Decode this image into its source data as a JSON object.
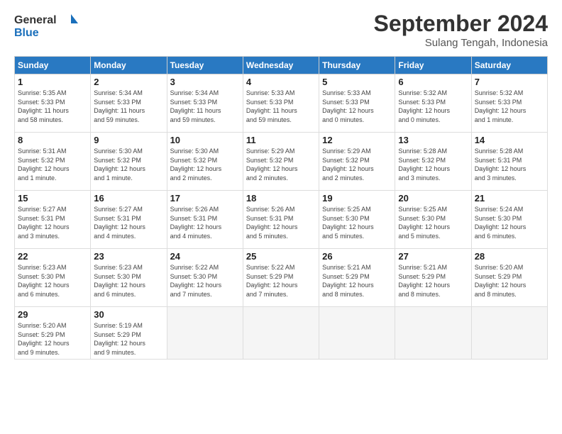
{
  "header": {
    "logo_line1": "General",
    "logo_line2": "Blue",
    "month": "September 2024",
    "location": "Sulang Tengah, Indonesia"
  },
  "weekdays": [
    "Sunday",
    "Monday",
    "Tuesday",
    "Wednesday",
    "Thursday",
    "Friday",
    "Saturday"
  ],
  "weeks": [
    [
      {
        "day": "1",
        "info": "Sunrise: 5:35 AM\nSunset: 5:33 PM\nDaylight: 11 hours\nand 58 minutes."
      },
      {
        "day": "2",
        "info": "Sunrise: 5:34 AM\nSunset: 5:33 PM\nDaylight: 11 hours\nand 59 minutes."
      },
      {
        "day": "3",
        "info": "Sunrise: 5:34 AM\nSunset: 5:33 PM\nDaylight: 11 hours\nand 59 minutes."
      },
      {
        "day": "4",
        "info": "Sunrise: 5:33 AM\nSunset: 5:33 PM\nDaylight: 11 hours\nand 59 minutes."
      },
      {
        "day": "5",
        "info": "Sunrise: 5:33 AM\nSunset: 5:33 PM\nDaylight: 12 hours\nand 0 minutes."
      },
      {
        "day": "6",
        "info": "Sunrise: 5:32 AM\nSunset: 5:33 PM\nDaylight: 12 hours\nand 0 minutes."
      },
      {
        "day": "7",
        "info": "Sunrise: 5:32 AM\nSunset: 5:33 PM\nDaylight: 12 hours\nand 1 minute."
      }
    ],
    [
      {
        "day": "8",
        "info": "Sunrise: 5:31 AM\nSunset: 5:32 PM\nDaylight: 12 hours\nand 1 minute."
      },
      {
        "day": "9",
        "info": "Sunrise: 5:30 AM\nSunset: 5:32 PM\nDaylight: 12 hours\nand 1 minute."
      },
      {
        "day": "10",
        "info": "Sunrise: 5:30 AM\nSunset: 5:32 PM\nDaylight: 12 hours\nand 2 minutes."
      },
      {
        "day": "11",
        "info": "Sunrise: 5:29 AM\nSunset: 5:32 PM\nDaylight: 12 hours\nand 2 minutes."
      },
      {
        "day": "12",
        "info": "Sunrise: 5:29 AM\nSunset: 5:32 PM\nDaylight: 12 hours\nand 2 minutes."
      },
      {
        "day": "13",
        "info": "Sunrise: 5:28 AM\nSunset: 5:32 PM\nDaylight: 12 hours\nand 3 minutes."
      },
      {
        "day": "14",
        "info": "Sunrise: 5:28 AM\nSunset: 5:31 PM\nDaylight: 12 hours\nand 3 minutes."
      }
    ],
    [
      {
        "day": "15",
        "info": "Sunrise: 5:27 AM\nSunset: 5:31 PM\nDaylight: 12 hours\nand 3 minutes."
      },
      {
        "day": "16",
        "info": "Sunrise: 5:27 AM\nSunset: 5:31 PM\nDaylight: 12 hours\nand 4 minutes."
      },
      {
        "day": "17",
        "info": "Sunrise: 5:26 AM\nSunset: 5:31 PM\nDaylight: 12 hours\nand 4 minutes."
      },
      {
        "day": "18",
        "info": "Sunrise: 5:26 AM\nSunset: 5:31 PM\nDaylight: 12 hours\nand 5 minutes."
      },
      {
        "day": "19",
        "info": "Sunrise: 5:25 AM\nSunset: 5:30 PM\nDaylight: 12 hours\nand 5 minutes."
      },
      {
        "day": "20",
        "info": "Sunrise: 5:25 AM\nSunset: 5:30 PM\nDaylight: 12 hours\nand 5 minutes."
      },
      {
        "day": "21",
        "info": "Sunrise: 5:24 AM\nSunset: 5:30 PM\nDaylight: 12 hours\nand 6 minutes."
      }
    ],
    [
      {
        "day": "22",
        "info": "Sunrise: 5:23 AM\nSunset: 5:30 PM\nDaylight: 12 hours\nand 6 minutes."
      },
      {
        "day": "23",
        "info": "Sunrise: 5:23 AM\nSunset: 5:30 PM\nDaylight: 12 hours\nand 6 minutes."
      },
      {
        "day": "24",
        "info": "Sunrise: 5:22 AM\nSunset: 5:30 PM\nDaylight: 12 hours\nand 7 minutes."
      },
      {
        "day": "25",
        "info": "Sunrise: 5:22 AM\nSunset: 5:29 PM\nDaylight: 12 hours\nand 7 minutes."
      },
      {
        "day": "26",
        "info": "Sunrise: 5:21 AM\nSunset: 5:29 PM\nDaylight: 12 hours\nand 8 minutes."
      },
      {
        "day": "27",
        "info": "Sunrise: 5:21 AM\nSunset: 5:29 PM\nDaylight: 12 hours\nand 8 minutes."
      },
      {
        "day": "28",
        "info": "Sunrise: 5:20 AM\nSunset: 5:29 PM\nDaylight: 12 hours\nand 8 minutes."
      }
    ],
    [
      {
        "day": "29",
        "info": "Sunrise: 5:20 AM\nSunset: 5:29 PM\nDaylight: 12 hours\nand 9 minutes."
      },
      {
        "day": "30",
        "info": "Sunrise: 5:19 AM\nSunset: 5:29 PM\nDaylight: 12 hours\nand 9 minutes."
      },
      {
        "day": "",
        "info": ""
      },
      {
        "day": "",
        "info": ""
      },
      {
        "day": "",
        "info": ""
      },
      {
        "day": "",
        "info": ""
      },
      {
        "day": "",
        "info": ""
      }
    ]
  ]
}
